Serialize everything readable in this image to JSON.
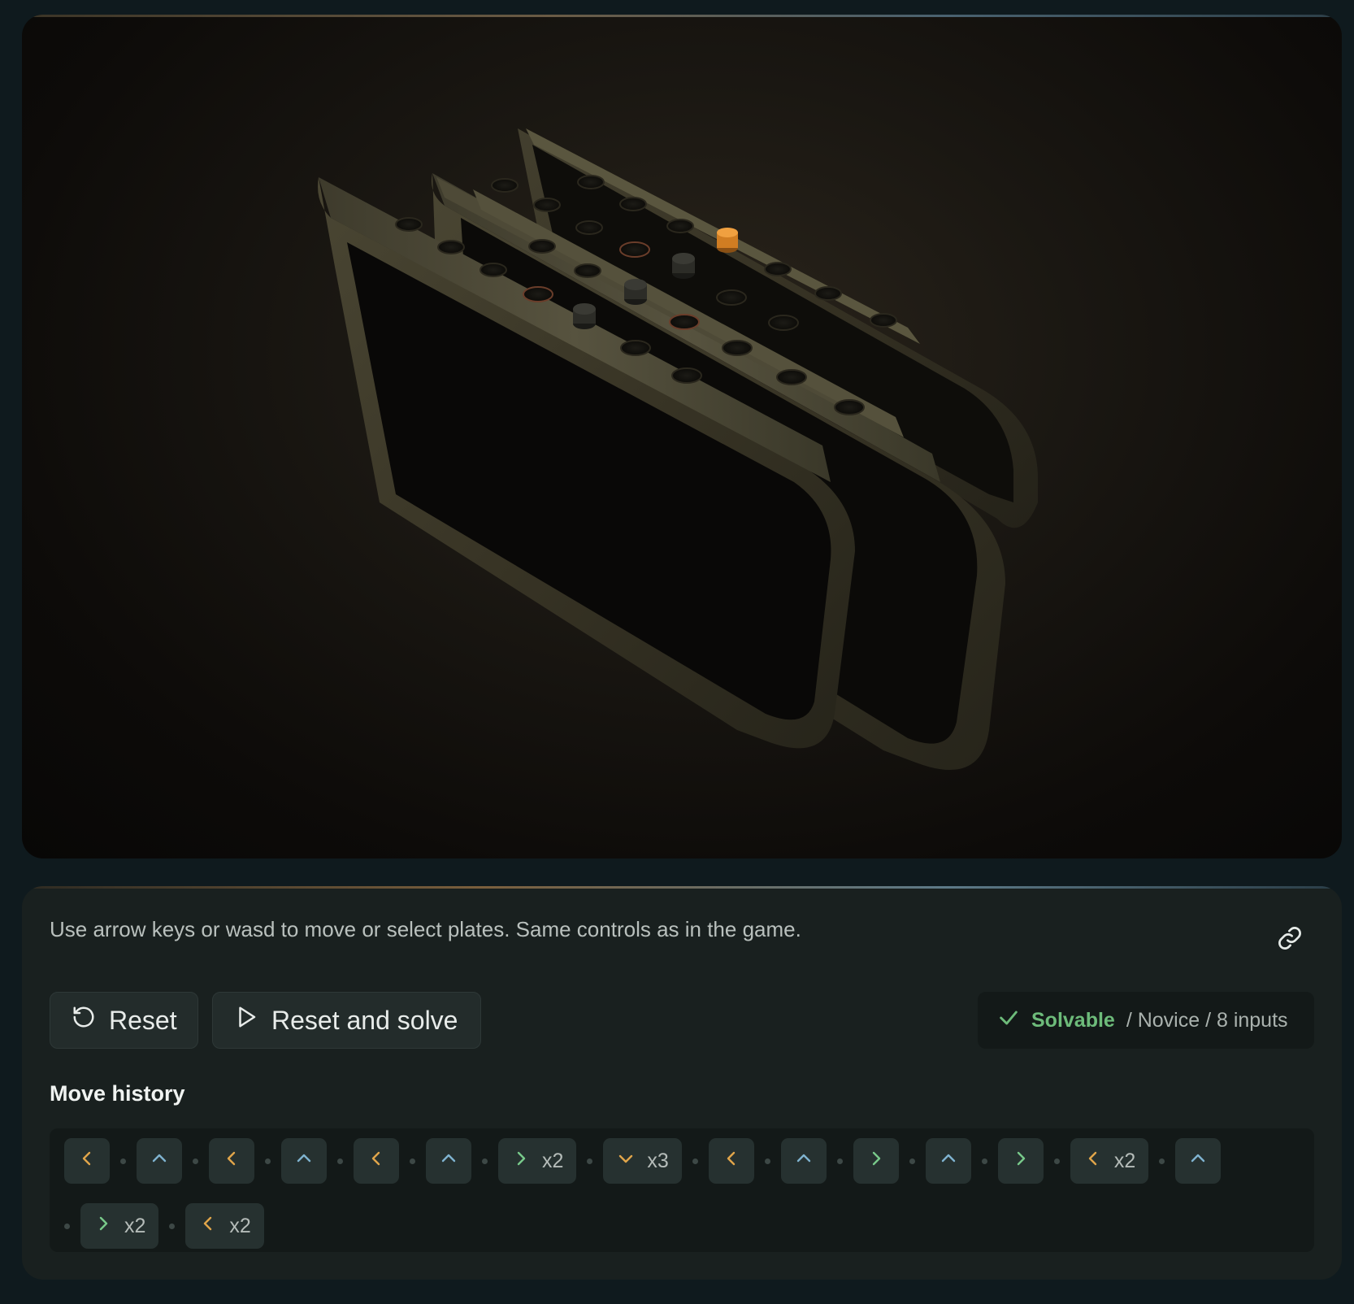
{
  "instructions": "Use arrow keys or wasd to move or select plates. Same controls as in the game.",
  "buttons": {
    "reset_label": "Reset",
    "solve_label": "Reset and solve"
  },
  "status": {
    "solvable": "Solvable",
    "details": "/ Novice / 8 inputs"
  },
  "history": {
    "title": "Move history",
    "moves": [
      {
        "dir": "left",
        "count": ""
      },
      {
        "dir": "up",
        "count": ""
      },
      {
        "dir": "left",
        "count": ""
      },
      {
        "dir": "up",
        "count": ""
      },
      {
        "dir": "left",
        "count": ""
      },
      {
        "dir": "up",
        "count": ""
      },
      {
        "dir": "right",
        "count": "x2"
      },
      {
        "dir": "down",
        "count": "x3"
      },
      {
        "dir": "left",
        "count": ""
      },
      {
        "dir": "up",
        "count": ""
      },
      {
        "dir": "right",
        "count": ""
      },
      {
        "dir": "up",
        "count": ""
      },
      {
        "dir": "right",
        "count": ""
      },
      {
        "dir": "left",
        "count": "x2"
      },
      {
        "dir": "up",
        "count": ""
      },
      {
        "dir": "right",
        "count": "x2"
      },
      {
        "dir": "left",
        "count": "x2"
      }
    ]
  },
  "colors": {
    "left": "#e0a54a",
    "right": "#78c98a",
    "up": "#7fb3cf",
    "down": "#e0a54a",
    "peg_active": "#e08a2a",
    "solvable": "#6dbb7a"
  },
  "icons": {
    "reset": "rotate-ccw-icon",
    "solve": "play-icon",
    "link": "link-icon",
    "check": "check-icon"
  }
}
